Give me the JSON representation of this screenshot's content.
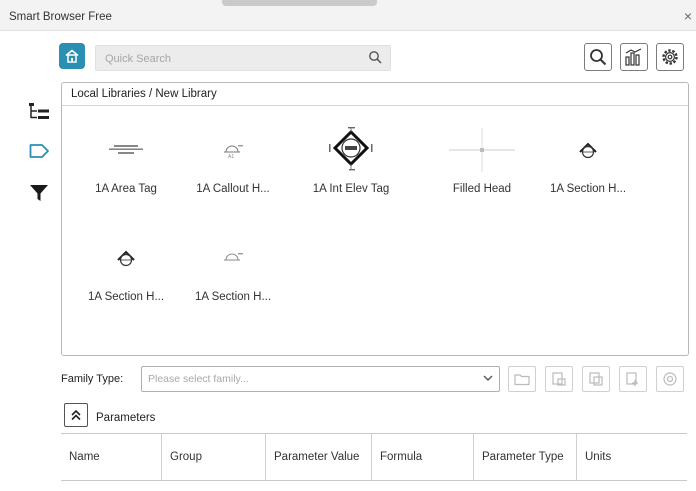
{
  "window": {
    "title": "Smart Browser Free",
    "close_label": "×"
  },
  "search": {
    "placeholder": "Quick Search"
  },
  "breadcrumb": "Local Libraries / New Library",
  "library_items": [
    {
      "label": "1A Area Tag"
    },
    {
      "label": "1A Callout H..."
    },
    {
      "label": "1A Int Elev Tag"
    },
    {
      "label": "Filled Head"
    },
    {
      "label": "1A Section H..."
    },
    {
      "label": "1A Section H..."
    },
    {
      "label": "1A Section H..."
    }
  ],
  "family_type": {
    "label": "Family Type:",
    "placeholder": "Please select family..."
  },
  "parameters": {
    "title": "Parameters",
    "columns": [
      "Name",
      "Group",
      "Parameter Value",
      "Formula",
      "Parameter Type",
      "Units"
    ]
  },
  "colors": {
    "accent": "#2b8fb2"
  }
}
